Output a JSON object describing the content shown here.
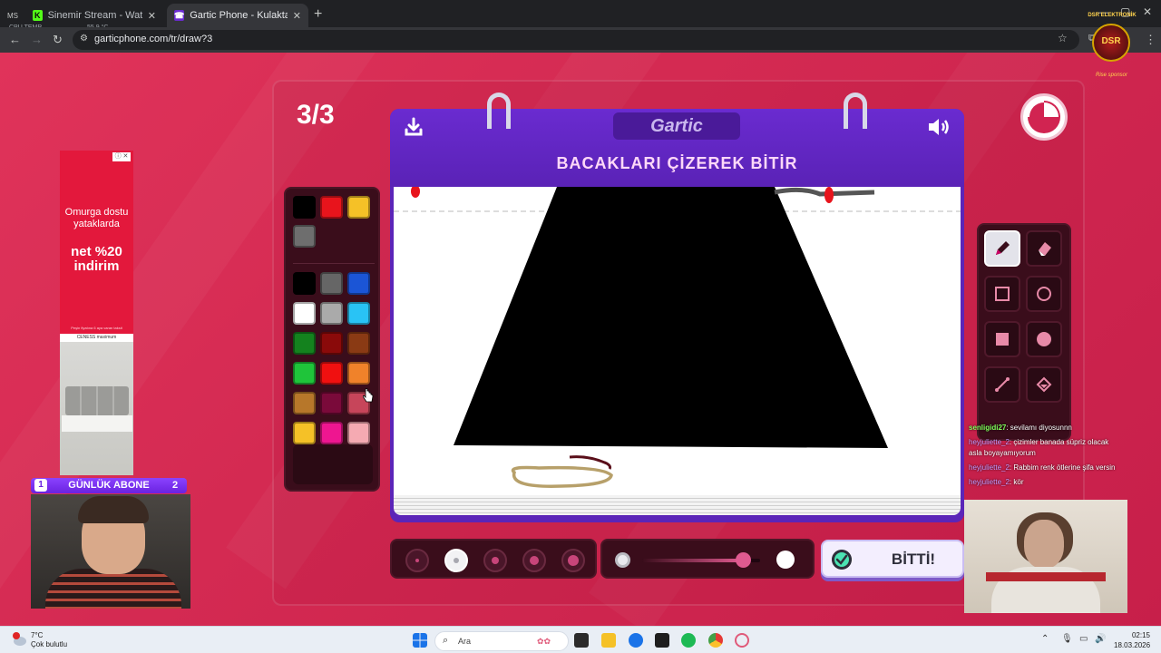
{
  "browser": {
    "tabs": [
      {
        "label": "Sinemir Stream - Watch Live on",
        "active": false
      },
      {
        "label": "Gartic Phone - Kulaktan Kulağa",
        "active": true
      }
    ],
    "url": "garticphone.com/tr/draw?3",
    "cpu_temp_label": "CPU TEMP",
    "cpu_temp_value": "55.9 °C"
  },
  "game": {
    "round": "3/3",
    "logo": "Gartic",
    "prompt": "BACAKLARI ÇİZEREK BİTİR",
    "done_label": "BİTTİ!",
    "timer_remaining_fraction": 0.75,
    "palette_top": [
      "#000000",
      "#e8141c",
      "#f5c127",
      "#6e6e6e"
    ],
    "palette": [
      [
        "#000000",
        "#666666",
        "#1b55d6"
      ],
      [
        "#ffffff",
        "#aaaaaa",
        "#29c3f5"
      ],
      [
        "#14821e",
        "#8a0a0a",
        "#8a3a14"
      ],
      [
        "#1fc43a",
        "#f01010",
        "#f0822a"
      ],
      [
        "#b7772a",
        "#7a0a3a",
        "#c7455a"
      ],
      [
        "#f5c127",
        "#ee1690",
        "#f5aab2"
      ]
    ],
    "brush_sizes": [
      1,
      2,
      3,
      4,
      5
    ],
    "selected_brush_size": 2,
    "opacity": 0.85,
    "tools": [
      {
        "name": "pencil",
        "icon": "pencil-icon",
        "selected": true
      },
      {
        "name": "eraser",
        "icon": "eraser-icon",
        "selected": false
      },
      {
        "name": "rectangle-outline",
        "icon": "square-outline-icon",
        "selected": false
      },
      {
        "name": "ellipse-outline",
        "icon": "circle-outline-icon",
        "selected": false
      },
      {
        "name": "rectangle-filled",
        "icon": "square-filled-icon",
        "selected": false
      },
      {
        "name": "ellipse-filled",
        "icon": "circle-filled-icon",
        "selected": false
      },
      {
        "name": "line",
        "icon": "line-icon",
        "selected": false
      },
      {
        "name": "fill",
        "icon": "fill-bucket-icon",
        "selected": false
      }
    ]
  },
  "overlay": {
    "ad": {
      "headline": "Omurga dostu yataklarda",
      "offer": "net %20 indirim",
      "fine_print": "Peşin fiyatına 6 aya varan taksit",
      "brands": "CENESS  maximum"
    },
    "subs": {
      "left": "1",
      "label": "GÜNLÜK ABONE",
      "right": "2"
    },
    "chat": [
      {
        "user": "senligidi27",
        "text": ": sevilamı diyosunnn"
      },
      {
        "user": "heyjuliette_2",
        "text": ": çizimler banada süpriz olacak asla boyayamıyorum"
      },
      {
        "user": "heyjuliette_2",
        "text": ": Rabbim renk ötlerine şifa versin"
      },
      {
        "user": "heyjuliette_2",
        "text": ": kör"
      }
    ],
    "sponsor": {
      "top": "DSR ELEKTRONİK",
      "badge": "DSR",
      "bottom": "Rise sponsor"
    }
  },
  "taskbar": {
    "weather_temp": "7°C",
    "weather_text": "Çok bulutlu",
    "search_placeholder": "Ara",
    "time": "02:15",
    "date": "18.03.2026"
  }
}
